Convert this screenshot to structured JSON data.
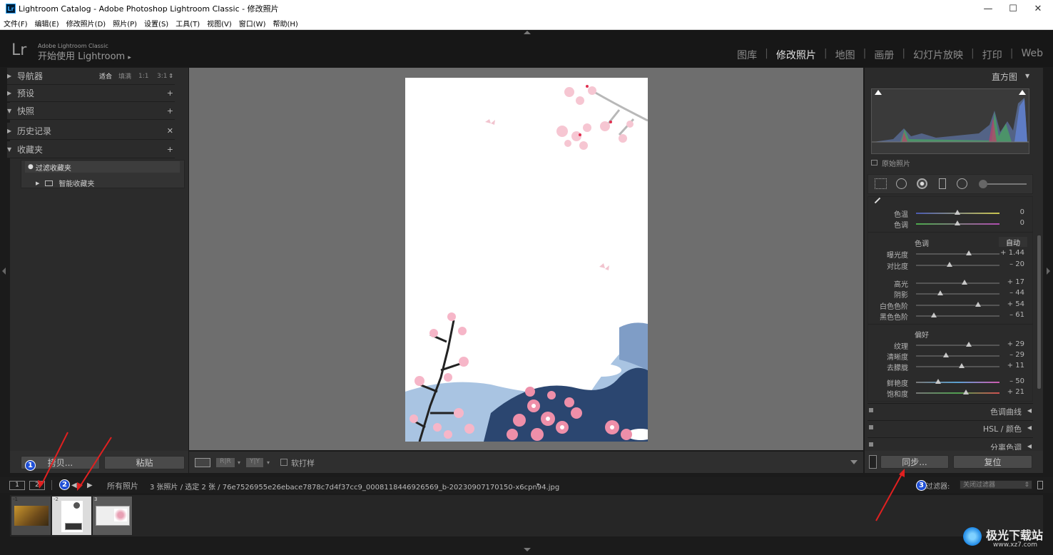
{
  "window": {
    "title": "Lightroom Catalog - Adobe Photoshop Lightroom Classic - 修改照片",
    "app_icon": "Lr",
    "controls": [
      "minimize",
      "maximize",
      "close"
    ]
  },
  "menu": [
    "文件(F)",
    "编辑(E)",
    "修改照片(D)",
    "照片(P)",
    "设置(S)",
    "工具(T)",
    "视图(V)",
    "窗口(W)",
    "帮助(H)"
  ],
  "identity": {
    "logo": "Lr",
    "subtitle": "Adobe Lightroom Classic",
    "title": "开始使用 Lightroom"
  },
  "modules": [
    {
      "label": "图库",
      "active": false
    },
    {
      "label": "修改照片",
      "active": true
    },
    {
      "label": "地图",
      "active": false
    },
    {
      "label": "画册",
      "active": false
    },
    {
      "label": "幻灯片放映",
      "active": false
    },
    {
      "label": "打印",
      "active": false
    },
    {
      "label": "Web",
      "active": false
    }
  ],
  "left": {
    "navigator": {
      "label": "导航器",
      "zoom": [
        "适合",
        "填满",
        "1:1",
        "3:1"
      ]
    },
    "presets": "预设",
    "snapshots": "快照",
    "history": "历史记录",
    "collections": "收藏夹",
    "filter_collections": "过滤收藏夹",
    "smart_collections": "智能收藏夹",
    "copy_button": "拷贝...",
    "paste_button": "粘贴"
  },
  "toolbar": {
    "proof": "软打样"
  },
  "right": {
    "histogram": "直方图",
    "original_photo": "原始照片",
    "sliders_top": [
      {
        "label": "色温",
        "value": "0",
        "pos": 0.5
      },
      {
        "label": "色调",
        "value": "0",
        "pos": 0.5
      }
    ],
    "tone_header": "色调",
    "auto": "自动",
    "tone": [
      {
        "label": "曝光度",
        "value": "+ 1.44",
        "pos": 0.64
      },
      {
        "label": "对比度",
        "value": "– 20",
        "pos": 0.4
      }
    ],
    "tone2": [
      {
        "label": "高光",
        "value": "+ 17",
        "pos": 0.58
      },
      {
        "label": "阴影",
        "value": "– 44",
        "pos": 0.29
      },
      {
        "label": "白色色阶",
        "value": "+ 54",
        "pos": 0.76
      },
      {
        "label": "黑色色阶",
        "value": "– 61",
        "pos": 0.21
      }
    ],
    "presence_header": "偏好",
    "presence": [
      {
        "label": "纹理",
        "value": "+ 29",
        "pos": 0.63
      },
      {
        "label": "清晰度",
        "value": "– 29",
        "pos": 0.37
      },
      {
        "label": "去朦胧",
        "value": "+ 11",
        "pos": 0.55
      }
    ],
    "presence2": [
      {
        "label": "鲜艳度",
        "value": "– 50",
        "pos": 0.27
      },
      {
        "label": "饱和度",
        "value": "+ 21",
        "pos": 0.6
      }
    ],
    "sections": [
      "色调曲线",
      "HSL / 颜色",
      "分离色调"
    ],
    "sync_button": "同步...",
    "reset_button": "复位"
  },
  "filmstrip": {
    "page1": "1",
    "page2": "2",
    "source": "所有照片",
    "count": "3 张照片 / 选定 2 张 / 76e7526955e26ebace7878c7d4f37cc9_0008118446926569_b-20230907170150-x6cpn94.jpg",
    "filter_label": "过滤器:",
    "filter_value": "关闭过滤器",
    "thumbs": [
      "-1",
      "-2",
      "3"
    ]
  },
  "annotations": [
    "1",
    "2",
    "3"
  ],
  "watermark": {
    "site": "极光下载站",
    "url": "www.xz7.com"
  }
}
